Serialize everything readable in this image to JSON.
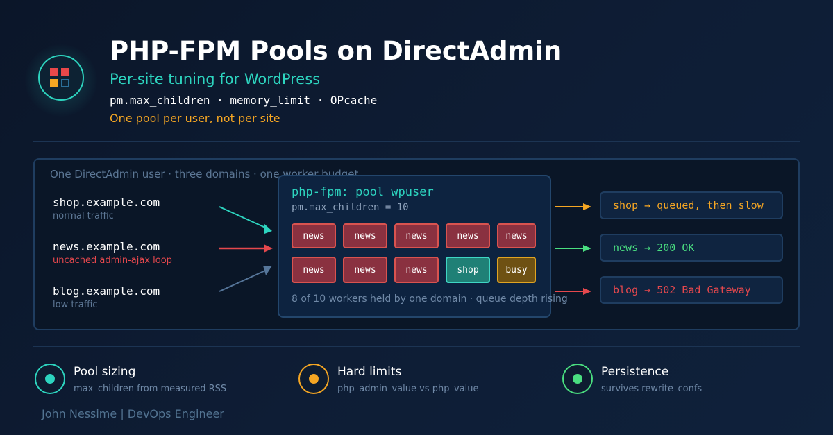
{
  "header": {
    "title": "PHP-FPM Pools on DirectAdmin",
    "subtitle": "Per-site tuning for WordPress",
    "params": "pm.max_children · memory_limit · OPcache",
    "note": "One pool per user, not per site"
  },
  "logo": {
    "icon": "app-grid-icon",
    "colors": [
      "#e8484a",
      "#e8484a",
      "#f5a623",
      "#2b6f9a"
    ]
  },
  "panel": {
    "caption": "One DirectAdmin user · three domains · one worker budget",
    "domains": [
      {
        "name": "shop.example.com",
        "note": "normal traffic",
        "note_color": "#5e7896",
        "arrow_color": "#2dd4bf"
      },
      {
        "name": "news.example.com",
        "note": "uncached admin-ajax loop",
        "note_color": "#e5484d",
        "arrow_color": "#e5484d"
      },
      {
        "name": "blog.example.com",
        "note": "low traffic",
        "note_color": "#5e7896",
        "arrow_color": "#56769a"
      }
    ],
    "pool": {
      "title": "php-fpm: pool wpuser",
      "setting": "pm.max_children = 10",
      "workers_row1": [
        "news",
        "news",
        "news",
        "news",
        "news"
      ],
      "workers_row2": [
        "news",
        "news",
        "news",
        "shop",
        "busy"
      ],
      "status": "8 of 10 workers held by one domain · queue depth rising"
    },
    "results": [
      {
        "text": "shop → queued, then slow",
        "color": "#f5a623"
      },
      {
        "text": "news → 200 OK",
        "color": "#4ade80"
      },
      {
        "text": "blog → 502 Bad Gateway",
        "color": "#e5484d"
      }
    ]
  },
  "features": [
    {
      "title": "Pool sizing",
      "subtitle": "max_children from measured RSS",
      "color": "#2dd4bf"
    },
    {
      "title": "Hard limits",
      "subtitle": "php_admin_value vs php_value",
      "color": "#f5a623"
    },
    {
      "title": "Persistence",
      "subtitle": "survives rewrite_confs",
      "color": "#4ade80"
    }
  ],
  "author": "John Nessime | DevOps Engineer"
}
